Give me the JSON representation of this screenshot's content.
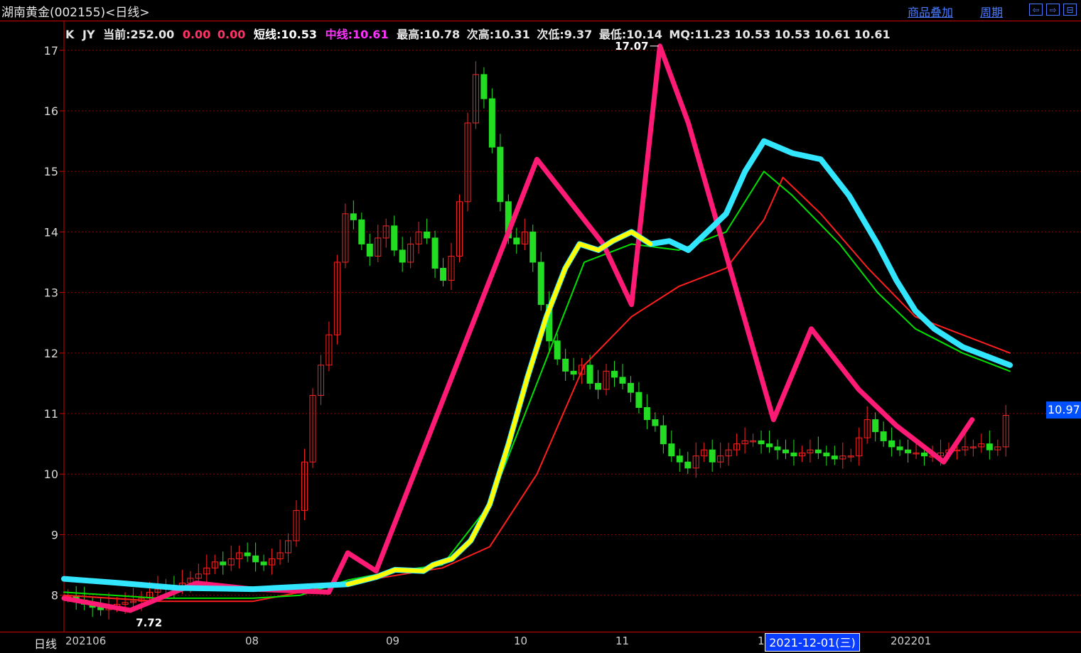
{
  "window": {
    "title": "湖南黄金(002155)<日线>",
    "overlay_link": "商品叠加",
    "period_link": "周期",
    "nav_buttons": [
      "⇦",
      "⇨",
      "⊟"
    ]
  },
  "info_bar": {
    "k": "K",
    "jy": "JY",
    "current": "当前:252.00",
    "v1": "0.00",
    "v2": "0.00",
    "short": "短线:10.53",
    "mid": "中线:10.61",
    "high": "最高:10.78",
    "second_high": "次高:10.31",
    "second_low": "次低:9.37",
    "low": "最低:10.14",
    "mq": "MQ:11.23 10.53 10.53 10.61 10.61",
    "colors": {
      "k": "#e6e6e6",
      "v": "#ff3366",
      "short": "#ffffff",
      "mid": "#ff33ff",
      "rest": "#e6e6e6"
    }
  },
  "footer": {
    "period_label": "日线",
    "x_labels": [
      "202106",
      "08",
      "09",
      "10",
      "11",
      "1",
      "202201"
    ],
    "cursor_date": "2021-12-01(三)",
    "last_price_box": "10.97"
  },
  "chart_data": {
    "type": "candlestick",
    "ylim": [
      7.55,
      17.15
    ],
    "y_ticks": [
      8,
      9,
      10,
      11,
      12,
      13,
      14,
      15,
      16,
      17
    ],
    "annotations": {
      "max_label": "17.07",
      "min_label": "7.72"
    },
    "colors": {
      "up": "#ff2020",
      "down": "#22dd22",
      "grid": "#9a0000",
      "zigzag": "#ff1a75",
      "cyan": "#33e6ff",
      "yellow": "#ffff00",
      "red_ma": "#ff1e1e",
      "green_ma": "#00e000"
    },
    "close_path": [
      7.98,
      7.92,
      7.85,
      7.8,
      7.76,
      7.82,
      7.85,
      7.88,
      7.9,
      7.95,
      8.05,
      8.1,
      8.15,
      8.12,
      8.2,
      8.28,
      8.35,
      8.45,
      8.55,
      8.5,
      8.6,
      8.7,
      8.65,
      8.55,
      8.5,
      8.6,
      8.7,
      8.9,
      9.4,
      10.2,
      11.3,
      11.8,
      12.3,
      13.5,
      14.3,
      14.2,
      13.8,
      13.6,
      13.9,
      14.1,
      13.7,
      13.5,
      13.8,
      14.0,
      13.9,
      13.4,
      13.2,
      13.6,
      14.5,
      15.8,
      16.6,
      16.2,
      15.4,
      14.5,
      13.9,
      13.8,
      14.0,
      13.5,
      12.8,
      12.2,
      11.9,
      11.7,
      11.65,
      11.8,
      11.5,
      11.4,
      11.7,
      11.6,
      11.5,
      11.35,
      11.1,
      10.9,
      10.8,
      10.5,
      10.3,
      10.2,
      10.1,
      10.3,
      10.4,
      10.2,
      10.3,
      10.4,
      10.5,
      10.55,
      10.55,
      10.5,
      10.45,
      10.4,
      10.35,
      10.3,
      10.35,
      10.4,
      10.35,
      10.3,
      10.25,
      10.3,
      10.3,
      10.6,
      10.9,
      10.7,
      10.55,
      10.45,
      10.4,
      10.35,
      10.35,
      10.3,
      10.3,
      10.35,
      10.4,
      10.4,
      10.45,
      10.45,
      10.5,
      10.4,
      10.45,
      10.97
    ],
    "ma_cyan": [
      [
        0,
        8.27
      ],
      [
        0.06,
        8.2
      ],
      [
        0.12,
        8.12
      ],
      [
        0.2,
        8.1
      ],
      [
        0.26,
        8.15
      ],
      [
        0.3,
        8.18
      ],
      [
        0.33,
        8.3
      ],
      [
        0.35,
        8.42
      ],
      [
        0.38,
        8.4
      ],
      [
        0.39,
        8.5
      ],
      [
        0.41,
        8.6
      ],
      [
        0.43,
        8.9
      ],
      [
        0.45,
        9.5
      ],
      [
        0.47,
        10.5
      ],
      [
        0.49,
        11.6
      ],
      [
        0.51,
        12.6
      ],
      [
        0.53,
        13.4
      ],
      [
        0.545,
        13.8
      ],
      [
        0.565,
        13.7
      ],
      [
        0.58,
        13.85
      ],
      [
        0.6,
        14.0
      ],
      [
        0.62,
        13.8
      ],
      [
        0.64,
        13.85
      ],
      [
        0.66,
        13.7
      ],
      [
        0.7,
        14.3
      ],
      [
        0.72,
        15.0
      ],
      [
        0.74,
        15.5
      ],
      [
        0.77,
        15.3
      ],
      [
        0.8,
        15.2
      ],
      [
        0.83,
        14.6
      ],
      [
        0.86,
        13.8
      ],
      [
        0.88,
        13.2
      ],
      [
        0.9,
        12.7
      ],
      [
        0.92,
        12.4
      ],
      [
        0.95,
        12.1
      ],
      [
        1.0,
        11.8
      ]
    ],
    "ma_green": [
      [
        0,
        8.05
      ],
      [
        0.1,
        7.95
      ],
      [
        0.2,
        7.95
      ],
      [
        0.25,
        8.0
      ],
      [
        0.3,
        8.25
      ],
      [
        0.35,
        8.4
      ],
      [
        0.4,
        8.5
      ],
      [
        0.45,
        9.5
      ],
      [
        0.5,
        11.5
      ],
      [
        0.55,
        13.5
      ],
      [
        0.6,
        13.8
      ],
      [
        0.65,
        13.7
      ],
      [
        0.7,
        14.0
      ],
      [
        0.74,
        15.0
      ],
      [
        0.77,
        14.6
      ],
      [
        0.82,
        13.8
      ],
      [
        0.86,
        13.0
      ],
      [
        0.9,
        12.4
      ],
      [
        0.95,
        12.0
      ],
      [
        1.0,
        11.7
      ]
    ],
    "ma_red": [
      [
        0,
        8.0
      ],
      [
        0.1,
        7.9
      ],
      [
        0.2,
        7.9
      ],
      [
        0.3,
        8.2
      ],
      [
        0.4,
        8.45
      ],
      [
        0.45,
        8.8
      ],
      [
        0.5,
        10.0
      ],
      [
        0.55,
        11.8
      ],
      [
        0.6,
        12.6
      ],
      [
        0.65,
        13.1
      ],
      [
        0.7,
        13.4
      ],
      [
        0.74,
        14.2
      ],
      [
        0.76,
        14.9
      ],
      [
        0.8,
        14.3
      ],
      [
        0.85,
        13.4
      ],
      [
        0.9,
        12.6
      ],
      [
        1.0,
        12.0
      ]
    ],
    "zigzag": [
      [
        0,
        7.95
      ],
      [
        0.07,
        7.75
      ],
      [
        0.14,
        8.2
      ],
      [
        0.2,
        8.1
      ],
      [
        0.28,
        8.05
      ],
      [
        0.3,
        8.7
      ],
      [
        0.33,
        8.4
      ],
      [
        0.5,
        15.2
      ],
      [
        0.57,
        13.8
      ],
      [
        0.6,
        12.8
      ],
      [
        0.63,
        17.07
      ],
      [
        0.66,
        15.8
      ],
      [
        0.75,
        10.9
      ],
      [
        0.79,
        12.4
      ],
      [
        0.84,
        11.4
      ],
      [
        0.88,
        10.8
      ],
      [
        0.93,
        10.2
      ],
      [
        0.96,
        10.9
      ]
    ]
  }
}
